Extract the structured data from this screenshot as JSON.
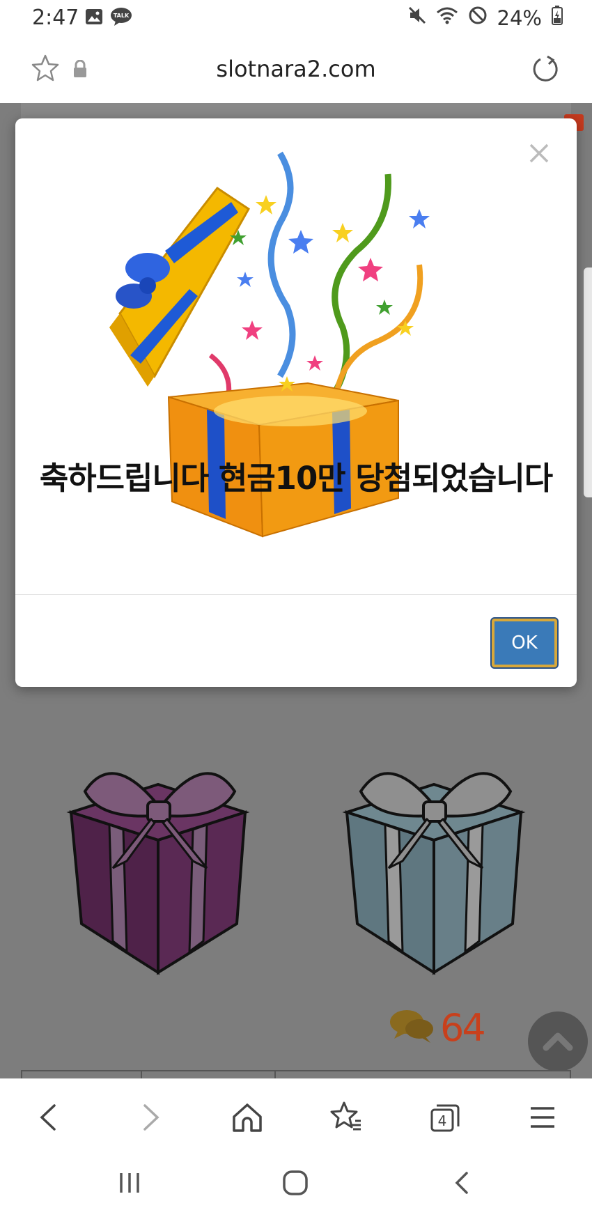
{
  "status_bar": {
    "time": "2:47",
    "battery": "24%",
    "icons": [
      "gallery-icon",
      "kakaotalk-icon",
      "mute-icon",
      "wifi-icon",
      "do-not-disturb-icon",
      "battery-charging-icon"
    ],
    "talk_label": "TALK"
  },
  "address_bar": {
    "url": "slotnara2.com",
    "icons": [
      "bookmark-star-icon",
      "lock-icon",
      "reload-icon"
    ]
  },
  "modal": {
    "headline": "축하드립니다 현금10만 당첨되었습니다",
    "ok_label": "OK",
    "close_icon": "close-icon"
  },
  "page": {
    "comment_count": "64",
    "gift_colors": [
      "#4f2249",
      "#5f7780"
    ]
  },
  "browser_nav": {
    "tabs_count": "4",
    "icons": [
      "back-icon",
      "forward-icon",
      "home-icon",
      "bookmarks-icon",
      "tabs-icon",
      "menu-icon"
    ]
  },
  "system_nav": {
    "icons": [
      "recents-icon",
      "home-circle-icon",
      "system-back-icon"
    ]
  },
  "colors": {
    "overlay": "#7d7d7d",
    "ok_button": "#3a7ab8",
    "ok_border": "#d8a83a",
    "comment_accent": "#c8401c"
  }
}
